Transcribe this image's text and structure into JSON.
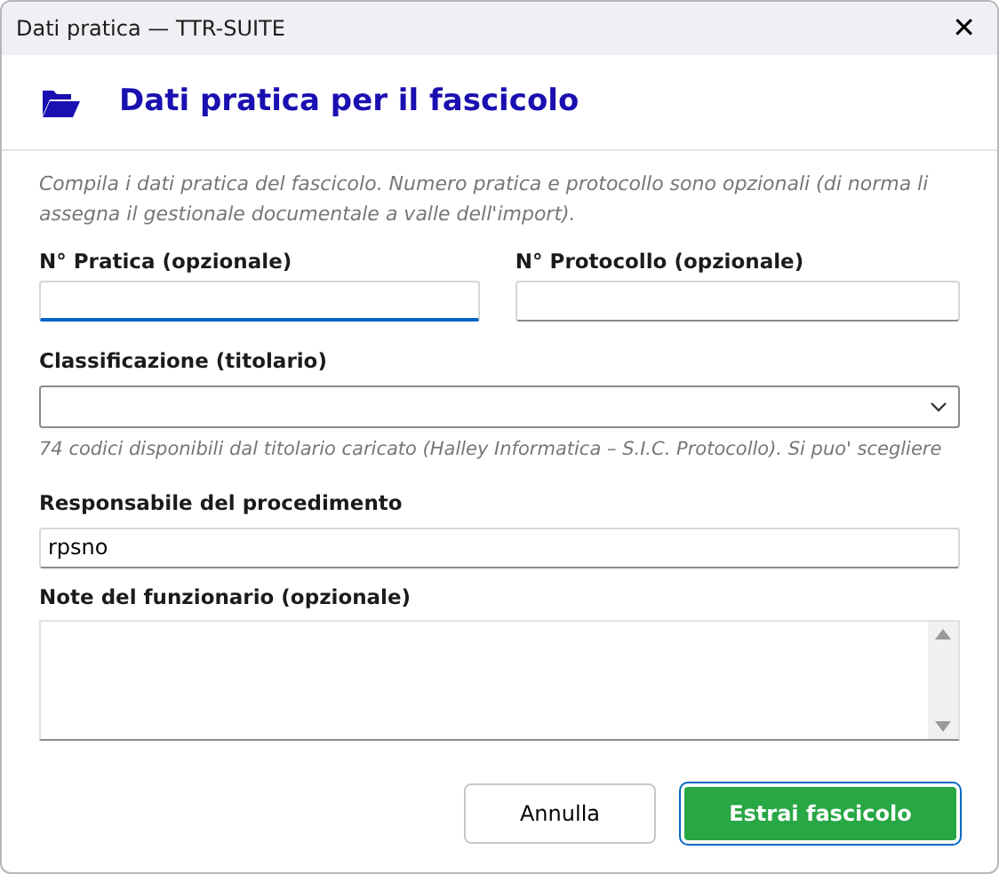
{
  "window": {
    "title": "Dati pratica — TTR-SUITE",
    "close": "✕"
  },
  "header": {
    "title": "Dati pratica per il fascicolo"
  },
  "intro": "Compila i dati pratica del fascicolo. Numero pratica e protocollo sono opzionali (di norma li assegna il gestionale documentale a valle dell'import).",
  "fields_row": [
    {
      "label": "N° Pratica (opzionale)",
      "focused": true
    },
    {
      "label": "N° Protocollo (opzionale)",
      "focused": false
    }
  ],
  "classification": {
    "label": "Classificazione (titolario)",
    "hint": "74 codici disponibili dal titolario caricato (Halley Informatica – S.I.C. Protocollo). Si puo' scegliere"
  },
  "manager": {
    "label": "Responsabile del procedimento",
    "value": "rpsno"
  },
  "notes": {
    "label": "Note del funzionario (opzionale)"
  },
  "buttons": [
    {
      "label": "Annulla",
      "kind": "secondary"
    },
    {
      "label": "Estrai fascicolo",
      "kind": "primary"
    }
  ]
}
